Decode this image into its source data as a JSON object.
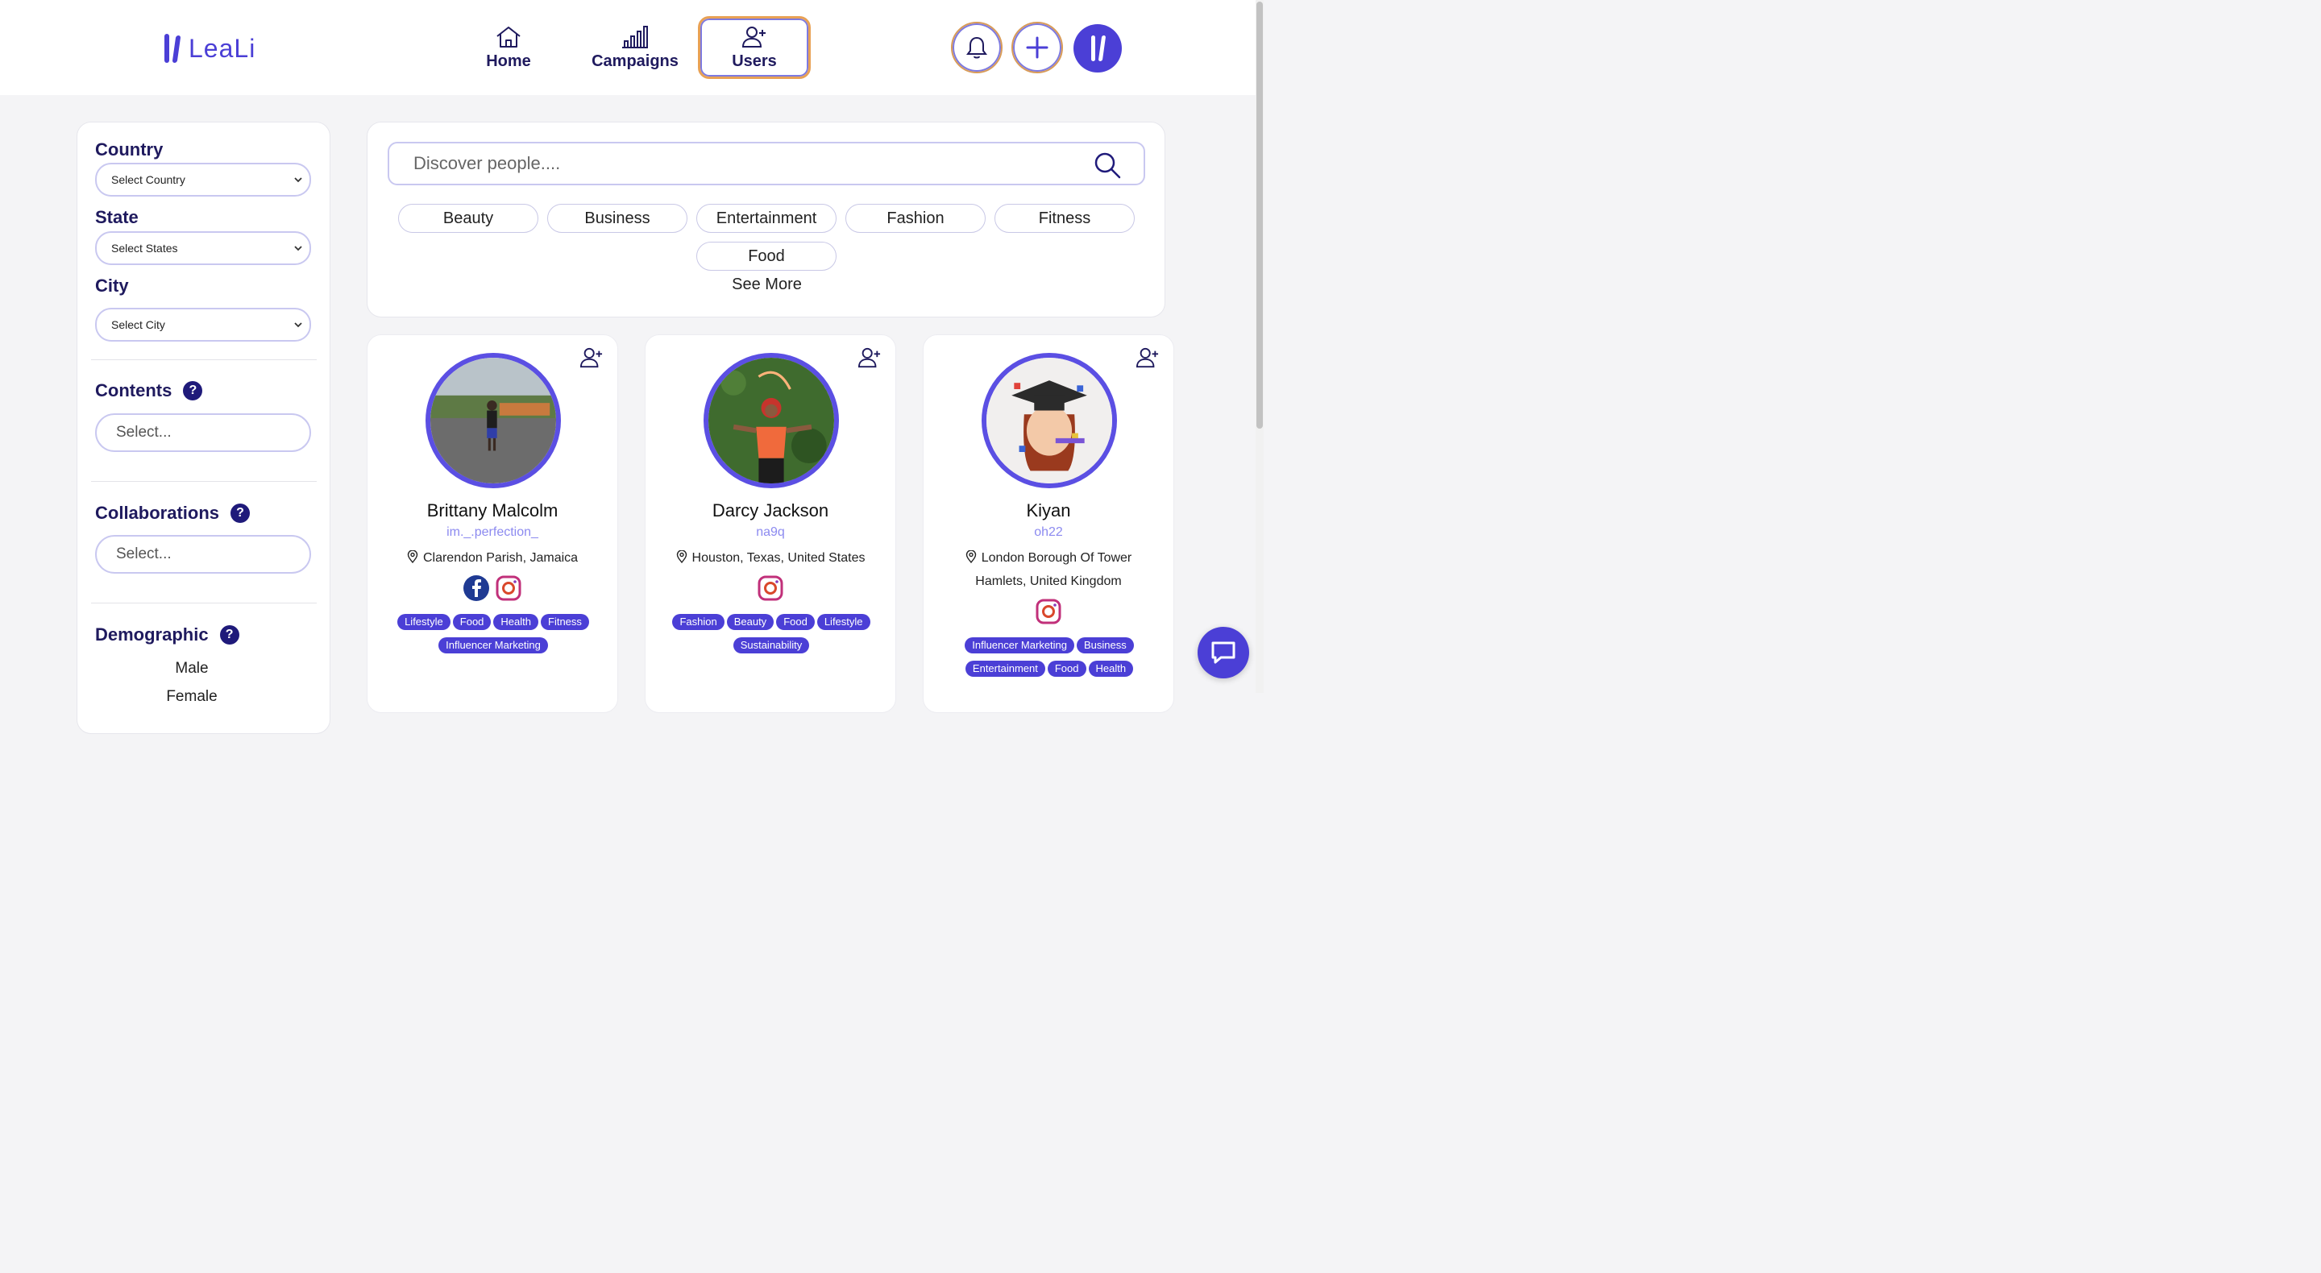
{
  "app": {
    "logo_text": "LeaLi"
  },
  "nav": [
    {
      "label": "Home",
      "icon": "home-icon"
    },
    {
      "label": "Campaigns",
      "icon": "bar-chart-icon"
    },
    {
      "label": "Users",
      "icon": "user-plus-icon",
      "active": true
    }
  ],
  "header_actions": [
    "bell-icon",
    "plus-icon",
    "profile-avatar"
  ],
  "filters": {
    "country": {
      "label": "Country",
      "value": "Select Country"
    },
    "state": {
      "label": "State",
      "value": "Select States"
    },
    "city": {
      "label": "City",
      "value": "Select City"
    },
    "contents": {
      "label": "Contents",
      "placeholder": "Select..."
    },
    "collaborations": {
      "label": "Collaborations",
      "placeholder": "Select..."
    },
    "demographic": {
      "label": "Demographic",
      "options": [
        "Male",
        "Female"
      ]
    }
  },
  "discover": {
    "placeholder": "Discover people....",
    "categories": [
      "Beauty",
      "Business",
      "Entertainment",
      "Fashion",
      "Fitness",
      "Food"
    ],
    "see_more": "See More"
  },
  "users": [
    {
      "name": "Brittany Malcolm",
      "handle": "im._.perfection_",
      "location": "Clarendon Parish, Jamaica",
      "socials": [
        "facebook-icon",
        "instagram-icon"
      ],
      "tags": [
        "Lifestyle",
        "Food",
        "Health",
        "Fitness",
        "Influencer Marketing"
      ]
    },
    {
      "name": "Darcy Jackson",
      "handle": "na9q",
      "location": "Houston, Texas, United States",
      "socials": [
        "instagram-icon"
      ],
      "tags": [
        "Fashion",
        "Beauty",
        "Food",
        "Lifestyle",
        "Sustainability"
      ]
    },
    {
      "name": "Kiyan",
      "handle": "oh22",
      "location": "London Borough Of Tower Hamlets, United Kingdom",
      "socials": [
        "instagram-icon"
      ],
      "tags": [
        "Influencer Marketing",
        "Business",
        "Entertainment",
        "Food",
        "Health"
      ]
    }
  ],
  "colors": {
    "primary": "#4b3fd6",
    "accent": "#e8a155",
    "handle": "#8c8af0",
    "heading": "#1f1a5e"
  }
}
